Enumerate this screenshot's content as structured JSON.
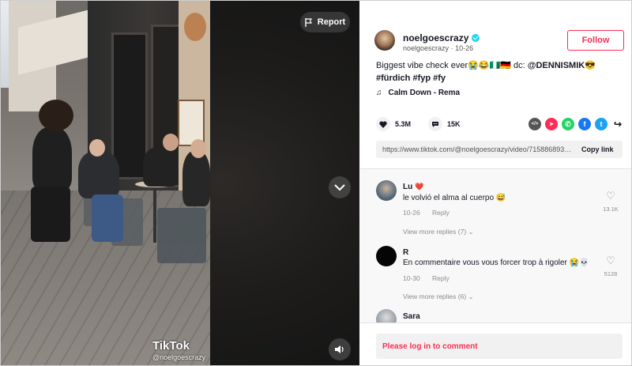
{
  "video": {
    "report_label": "Report",
    "watermark_brand": "TikTok",
    "watermark_user": "@noelgoescrazy"
  },
  "post": {
    "username": "noelgoescrazy",
    "handle": "noelgoescrazy",
    "date": "10-26",
    "follow_label": "Follow",
    "caption_text": "Biggest vibe check ever😭😂🇳🇬🇩🇪 dc: ",
    "caption_mention": "@DENNISMIK😎",
    "caption_tags": " #fürdich #fyp #fy",
    "music": "Calm Down - Rema",
    "likes": "5.3M",
    "comments": "15K",
    "link": "https://www.tiktok.com/@noelgoescrazy/video/7158868931...",
    "copy_link_label": "Copy link"
  },
  "share_icons": [
    {
      "name": "embed-icon",
      "glyph": "</>",
      "color": "#444"
    },
    {
      "name": "send-icon",
      "glyph": "➤",
      "color": "#fe2c55"
    },
    {
      "name": "whatsapp-icon",
      "glyph": "✆",
      "color": "#25d366"
    },
    {
      "name": "facebook-icon",
      "glyph": "f",
      "color": "#1877f2"
    },
    {
      "name": "twitter-icon",
      "glyph": "t",
      "color": "#1da1f2"
    }
  ],
  "comments": [
    {
      "name": "Lu",
      "badge": "❤️",
      "text": "le volvió el alma al cuerpo 😅",
      "date": "10-26",
      "reply": "Reply",
      "likes": "13.1K",
      "more": "View more replies (7)"
    },
    {
      "name": "R",
      "text": "En commentaire vous vous forcer trop à rigoler 😭💀",
      "date": "10-30",
      "reply": "Reply",
      "likes": "5128",
      "more": "View more replies (6)"
    },
    {
      "name": "Sara"
    }
  ],
  "login_prompt": "Please log in to comment"
}
